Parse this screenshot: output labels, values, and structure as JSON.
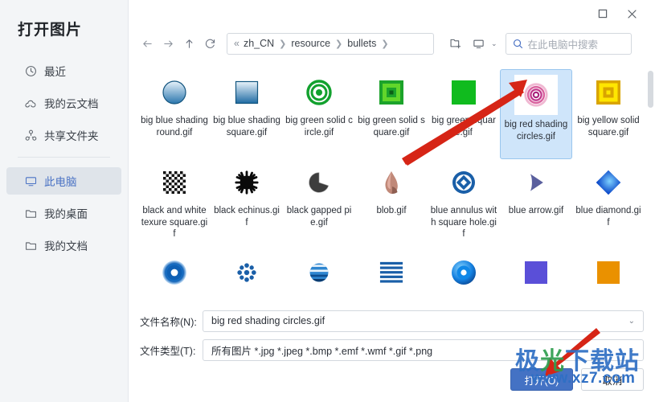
{
  "sidebar": {
    "title": "打开图片",
    "items": [
      {
        "label": "最近",
        "icon": "clock-icon",
        "active": false
      },
      {
        "label": "我的云文档",
        "icon": "cloud-icon",
        "active": false
      },
      {
        "label": "共享文件夹",
        "icon": "share-icon",
        "active": false
      },
      {
        "label": "此电脑",
        "icon": "monitor-icon",
        "active": true
      },
      {
        "label": "我的桌面",
        "icon": "folder-icon",
        "active": false
      },
      {
        "label": "我的文档",
        "icon": "folder-icon",
        "active": false
      }
    ]
  },
  "titlebar": {
    "maximize_label": "□",
    "close_label": "✕"
  },
  "toolbar": {
    "back": "back-arrow",
    "forward": "forward-arrow",
    "up": "up-arrow",
    "refresh": "refresh-arrow",
    "breadcrumb_lead": "«",
    "breadcrumb": [
      "zh_CN",
      "resource",
      "bullets"
    ],
    "breadcrumb_trailing": "›",
    "new_folder": "new-folder-icon",
    "view_mode": "view-mode-icon",
    "view_caret": "⌄"
  },
  "search": {
    "placeholder": "在此电脑中搜索",
    "icon": "search-icon"
  },
  "files": [
    {
      "name": "big blue shading round.gif",
      "icon": "blue-gradient-circle",
      "selected": false
    },
    {
      "name": "big blue shading square.gif",
      "icon": "blue-gradient-square",
      "selected": false
    },
    {
      "name": "big green solid circle.gif",
      "icon": "green-rings-circle",
      "selected": false
    },
    {
      "name": "big green solid square.gif",
      "icon": "green-nested-square",
      "selected": false
    },
    {
      "name": "big green square.gif",
      "icon": "green-flat-square",
      "selected": false
    },
    {
      "name": "big red shading circles.gif",
      "icon": "red-rings-circle",
      "selected": true
    },
    {
      "name": "big yellow solid square.gif",
      "icon": "yellow-nested-square",
      "selected": false
    },
    {
      "name": "black and white texure square.gif",
      "icon": "checker-square",
      "selected": false
    },
    {
      "name": "black echinus.gif",
      "icon": "black-starburst",
      "selected": false
    },
    {
      "name": "black gapped pie.gif",
      "icon": "black-gapped-pie",
      "selected": false
    },
    {
      "name": "blob.gif",
      "icon": "blob-shape",
      "selected": false
    },
    {
      "name": "blue annulus with square hole.gif",
      "icon": "blue-annulus-square-hole",
      "selected": false
    },
    {
      "name": "blue arrow.gif",
      "icon": "blue-triangle-arrow",
      "selected": false
    },
    {
      "name": "blue diamond.gif",
      "icon": "blue-diamond",
      "selected": false
    },
    {
      "name": "",
      "icon": "blue-donut",
      "selected": false
    },
    {
      "name": "",
      "icon": "blue-snowflake",
      "selected": false
    },
    {
      "name": "",
      "icon": "blue-striped-sphere",
      "selected": false
    },
    {
      "name": "",
      "icon": "blue-stripes-block",
      "selected": false
    },
    {
      "name": "",
      "icon": "blue-ring-donut",
      "selected": false
    },
    {
      "name": "",
      "icon": "purple-square",
      "selected": false
    },
    {
      "name": "",
      "icon": "orange-square",
      "selected": false
    }
  ],
  "form": {
    "filename_label": "文件名称(N):",
    "filename_value": "big red shading circles.gif",
    "filetype_label": "文件类型(T):",
    "filetype_value": "所有图片 *.jpg *.jpeg *.bmp *.emf *.wmf *.gif *.png",
    "caret": "⌄"
  },
  "buttons": {
    "open_label": "打开(O)",
    "cancel_label": "取消"
  },
  "watermark": {
    "brand_part1": "极",
    "brand_part2": "光",
    "brand_part3": "下载站",
    "url": "www.xz7.com"
  },
  "colors": {
    "accent": "#4472c4",
    "sidebar_bg": "#f3f5f7",
    "selection": "#cfe5fa",
    "annotation": "#d62516"
  }
}
